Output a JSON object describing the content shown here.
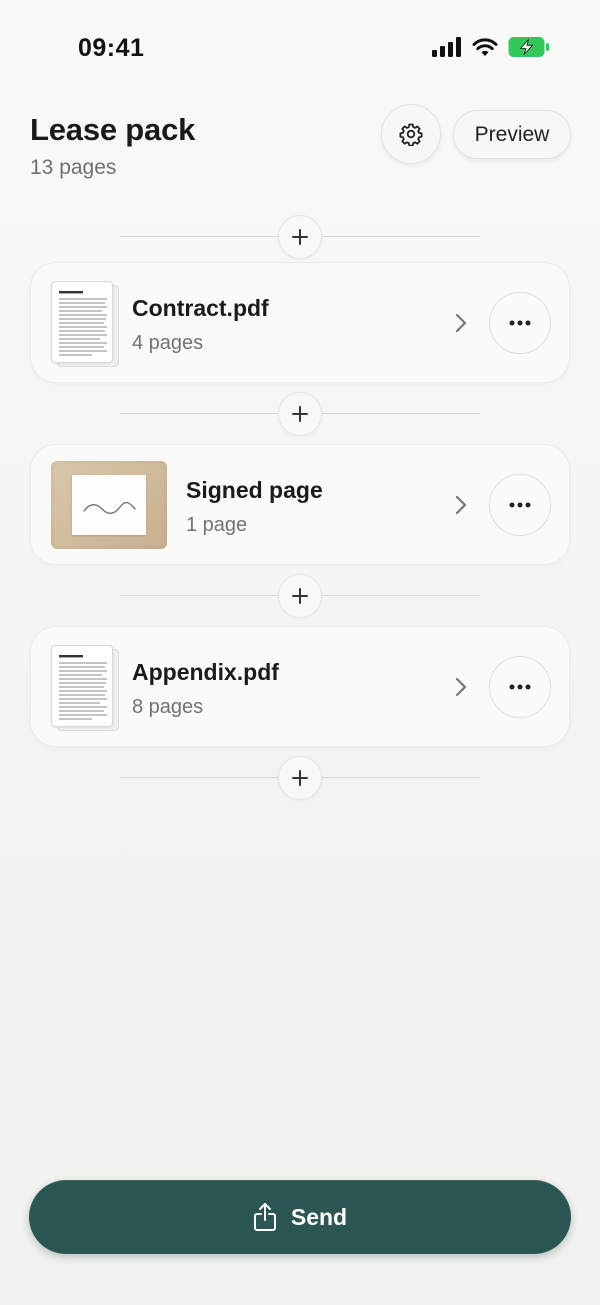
{
  "status_bar": {
    "time": "09:41",
    "battery_color": "#34c759"
  },
  "header": {
    "title": "Lease pack",
    "subtitle": "13 pages",
    "preview_label": "Preview",
    "settings_icon": "gear-icon"
  },
  "documents": [
    {
      "name": "Contract.pdf",
      "pages": "4 pages",
      "thumbnail": "pdf-document"
    },
    {
      "name": "Signed page",
      "pages": "1 page",
      "thumbnail": "photo-signature"
    },
    {
      "name": "Appendix.pdf",
      "pages": "8 pages",
      "thumbnail": "pdf-document"
    }
  ],
  "actions": {
    "send_label": "Send",
    "send_icon": "share-icon",
    "insert_icon": "plus-icon",
    "more_icon": "ellipsis-icon"
  },
  "colors": {
    "accent": "#2c5651",
    "background": "#f5f5f3"
  }
}
